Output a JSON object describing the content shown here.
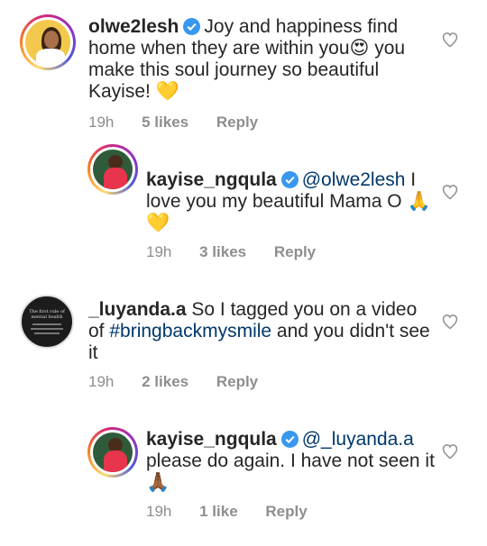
{
  "comments": [
    {
      "username": "olwe2lesh",
      "text": "Joy and happiness find home when they are within you😍 you make this soul journey so beautiful Kayise! 💛",
      "time": "19h",
      "likes": "5 likes",
      "reply": "Reply"
    },
    {
      "username": "kayise_ngqula",
      "mention": "@olwe2lesh",
      "text": " I love you my beautiful Mama O 🙏 💛",
      "time": "19h",
      "likes": "3 likes",
      "reply": "Reply"
    },
    {
      "username": "_luyanda.a",
      "pre": "So I tagged you on a video of ",
      "hashtag": "#bringbackmysmile",
      "post": " and you didn't see it",
      "avatar_text": "The first rule of mental health",
      "time": "19h",
      "likes": "2 likes",
      "reply": "Reply"
    },
    {
      "username": "kayise_ngqula",
      "mention": "@_luyanda.a",
      "text": " please do again. I have not seen it 🙏🏾",
      "time": "19h",
      "likes": "1 like",
      "reply": "Reply"
    }
  ],
  "icons": {
    "verified": "verified-badge-icon",
    "like": "heart-outline-icon"
  },
  "colors": {
    "verified": "#3897f0",
    "mention": "#00376b",
    "meta": "#8e8e8e"
  }
}
